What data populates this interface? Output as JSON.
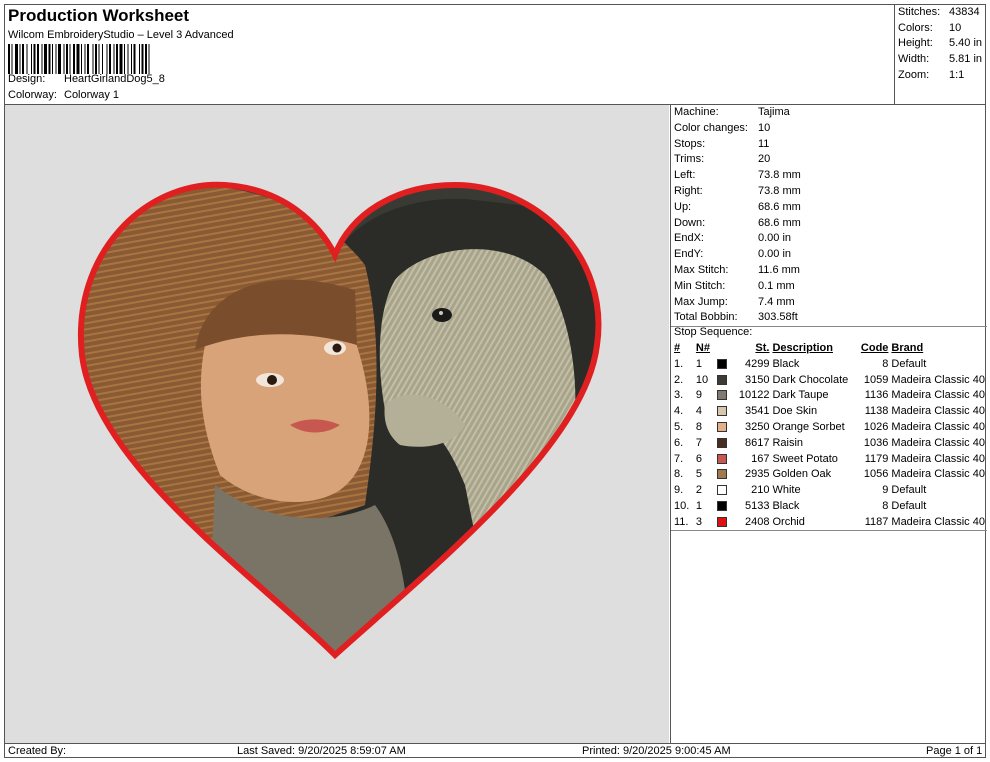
{
  "header": {
    "title": "Production Worksheet",
    "software": "Wilcom EmbroideryStudio – Level 3 Advanced",
    "design_label": "Design:",
    "design_value": "HeartGirlandDog5_8",
    "colorway_label": "Colorway:",
    "colorway_value": "Colorway 1"
  },
  "summary": [
    {
      "label": "Stitches:",
      "value": "43834"
    },
    {
      "label": "Colors:",
      "value": "10"
    },
    {
      "label": "Height:",
      "value": "5.40 in"
    },
    {
      "label": "Width:",
      "value": "5.81 in"
    },
    {
      "label": "Zoom:",
      "value": "1:1"
    }
  ],
  "machine_info": [
    {
      "label": "Machine:",
      "value": "Tajima"
    },
    {
      "label": "Color changes:",
      "value": "10"
    },
    {
      "label": "Stops:",
      "value": "11"
    },
    {
      "label": "Trims:",
      "value": "20"
    },
    {
      "label": "Left:",
      "value": "73.8 mm"
    },
    {
      "label": "Right:",
      "value": "73.8 mm"
    },
    {
      "label": "Up:",
      "value": "68.6 mm"
    },
    {
      "label": "Down:",
      "value": "68.6 mm"
    },
    {
      "label": "EndX:",
      "value": "0.00 in"
    },
    {
      "label": "EndY:",
      "value": "0.00 in"
    },
    {
      "label": "Max Stitch:",
      "value": "11.6 mm"
    },
    {
      "label": "Min Stitch:",
      "value": "0.1 mm"
    },
    {
      "label": "Max Jump:",
      "value": "7.4 mm"
    },
    {
      "label": "Total Bobbin:",
      "value": "303.58ft"
    }
  ],
  "stop_sequence": {
    "title": "Stop Sequence:",
    "columns": {
      "num": "#",
      "n": "N#",
      "st": "St.",
      "desc": "Description",
      "code": "Code",
      "brand": "Brand"
    },
    "rows": [
      {
        "num": "1.",
        "n": "1",
        "color": "#000000",
        "st": "4299",
        "desc": "Black",
        "code": "8",
        "brand": "Default"
      },
      {
        "num": "2.",
        "n": "10",
        "color": "#3e3a36",
        "st": "3150",
        "desc": "Dark Chocolate",
        "code": "1059",
        "brand": "Madeira Classic 40"
      },
      {
        "num": "3.",
        "n": "9",
        "color": "#827a70",
        "st": "10122",
        "desc": "Dark Taupe",
        "code": "1136",
        "brand": "Madeira Classic 40"
      },
      {
        "num": "4.",
        "n": "4",
        "color": "#d7c7aa",
        "st": "3541",
        "desc": "Doe Skin",
        "code": "1138",
        "brand": "Madeira Classic 40"
      },
      {
        "num": "5.",
        "n": "8",
        "color": "#e4b08c",
        "st": "3250",
        "desc": "Orange Sorbet",
        "code": "1026",
        "brand": "Madeira Classic 40"
      },
      {
        "num": "6.",
        "n": "7",
        "color": "#4a2b24",
        "st": "8617",
        "desc": "Raisin",
        "code": "1036",
        "brand": "Madeira Classic 40"
      },
      {
        "num": "7.",
        "n": "6",
        "color": "#c65850",
        "st": "167",
        "desc": "Sweet Potato",
        "code": "1179",
        "brand": "Madeira Classic 40"
      },
      {
        "num": "8.",
        "n": "5",
        "color": "#a07a4a",
        "st": "2935",
        "desc": "Golden Oak",
        "code": "1056",
        "brand": "Madeira Classic 40"
      },
      {
        "num": "9.",
        "n": "2",
        "color": "#ffffff",
        "st": "210",
        "desc": "White",
        "code": "9",
        "brand": "Default"
      },
      {
        "num": "10.",
        "n": "1",
        "color": "#000000",
        "st": "5133",
        "desc": "Black",
        "code": "8",
        "brand": "Default"
      },
      {
        "num": "11.",
        "n": "3",
        "color": "#e01010",
        "st": "2408",
        "desc": "Orchid",
        "code": "1187",
        "brand": "Madeira Classic 40"
      }
    ]
  },
  "footer": {
    "created_by": "Created By:",
    "last_saved": "Last Saved: 9/20/2025 8:59:07 AM",
    "printed": "Printed: 9/20/2025 9:00:45 AM",
    "page": "Page 1 of 1"
  },
  "design_colors": {
    "heart_border": "#e02020",
    "hair": "#8a5a34",
    "skin": "#d9a37a",
    "dog": "#a8a48c",
    "background_dark": "#3a3a34",
    "canvas": "#dedede"
  }
}
